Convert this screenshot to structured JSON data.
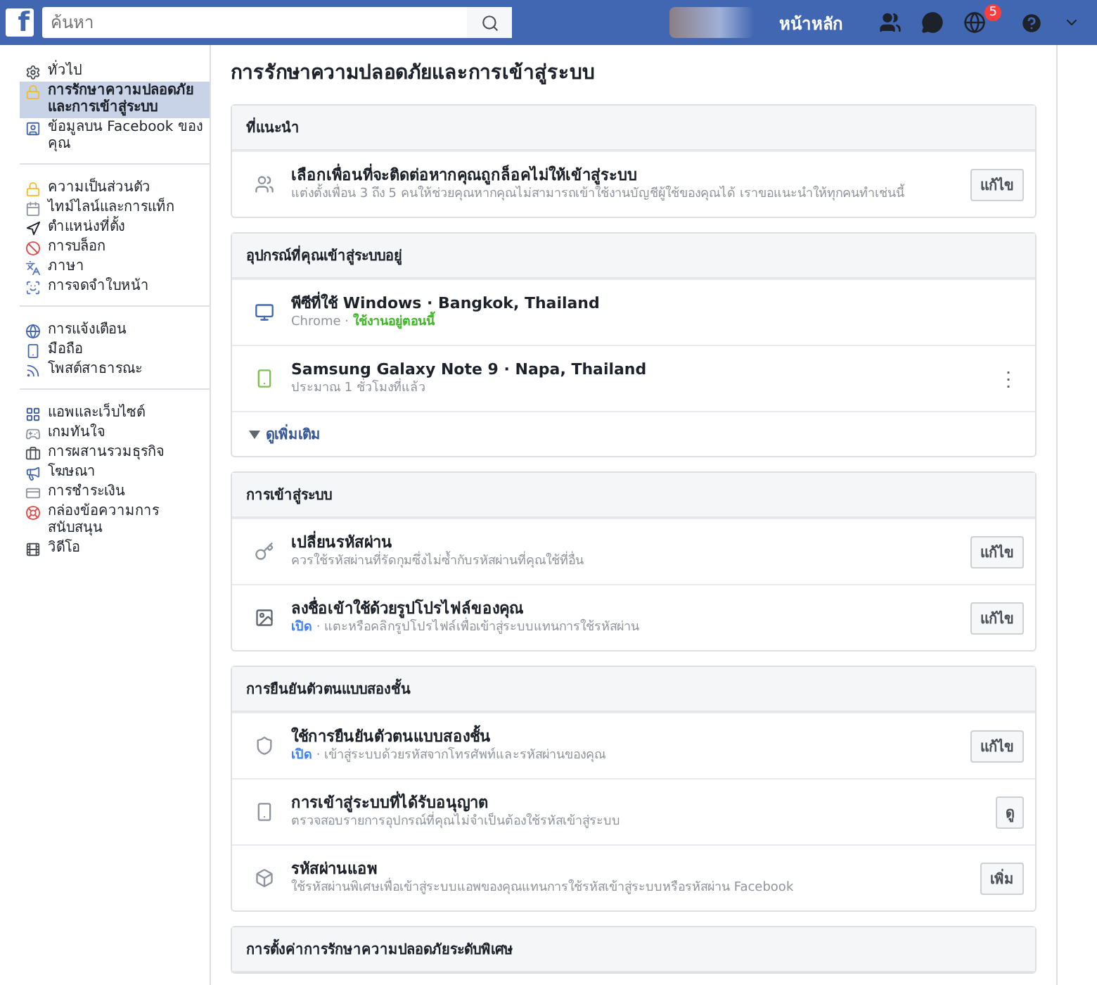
{
  "topbar": {
    "logo": "f",
    "search": {
      "placeholder": "ค้นหา"
    },
    "home": "หน้าหลัก",
    "notification_count": "5"
  },
  "sidebar": {
    "groups": [
      [
        {
          "label": "ทั่วไป",
          "selected": false
        },
        {
          "label": "การรักษาความปลอดภัยและการเข้าสู่ระบบ",
          "selected": true
        },
        {
          "label": "ข้อมูลบน Facebook ของคุณ",
          "selected": false
        }
      ],
      [
        {
          "label": "ความเป็นส่วนตัว",
          "selected": false
        },
        {
          "label": "ไทม์ไลน์และการแท็ก",
          "selected": false
        },
        {
          "label": "ตำแหน่งที่ตั้ง",
          "selected": false
        },
        {
          "label": "การบล็อก",
          "selected": false
        },
        {
          "label": "ภาษา",
          "selected": false
        },
        {
          "label": "การจดจำใบหน้า",
          "selected": false
        }
      ],
      [
        {
          "label": "การแจ้งเตือน",
          "selected": false
        },
        {
          "label": "มือถือ",
          "selected": false
        },
        {
          "label": "โพสต์สาธารณะ",
          "selected": false
        }
      ],
      [
        {
          "label": "แอพและเว็บไซต์",
          "selected": false
        },
        {
          "label": "เกมทันใจ",
          "selected": false
        },
        {
          "label": "การผสานรวมธุรกิจ",
          "selected": false
        },
        {
          "label": "โฆษณา",
          "selected": false
        },
        {
          "label": "การชำระเงิน",
          "selected": false
        },
        {
          "label": "กล่องข้อความการสนับสนุน",
          "selected": false
        },
        {
          "label": "วิดีโอ",
          "selected": false
        }
      ]
    ]
  },
  "title": "การรักษาความปลอดภัยและการเข้าสู่ระบบ",
  "sections": [
    {
      "header": "ที่แนะนำ",
      "rows": [
        {
          "kind": "setting",
          "title": "เลือกเพื่อนที่จะติดต่อหากคุณถูกล็อคไม่ให้เข้าสู่ระบบ",
          "description": "แต่งตั้งเพื่อน 3 ถึง 5 คนให้ช่วยคุณหากคุณไม่สามารถเข้าใช้งานบัญชีผู้ใช้ของคุณได้ เราขอแนะนำให้ทุกคนทำเช่นนี้",
          "button": "แก้ไข"
        }
      ]
    },
    {
      "header": "อุปกรณ์ที่คุณเข้าสู่ระบบอยู่",
      "rows": [
        {
          "kind": "device",
          "title": "พีซีที่ใช้ Windows · Bangkok, Thailand",
          "description": "Chrome ·",
          "status": "ใช้งานอยู่ตอนนี้"
        },
        {
          "kind": "device",
          "title": "Samsung Galaxy Note 9 · Napa, Thailand",
          "description": "ประมาณ 1 ชั่วโมงที่แล้ว",
          "menu": "⋮"
        }
      ],
      "more": "ดูเพิ่มเติม"
    },
    {
      "header": "การเข้าสู่ระบบ",
      "rows": [
        {
          "kind": "setting",
          "title": "เปลี่ยนรหัสผ่าน",
          "description": "ควรใช้รหัสผ่านที่รัดกุมซึ่งไม่ซ้ำกับรหัสผ่านที่คุณใช้ที่อื่น",
          "button": "แก้ไข"
        },
        {
          "kind": "setting",
          "title": "ลงชื่อเข้าใช้ด้วยรูปโปรไฟล์ของคุณ",
          "status": "เปิด",
          "description": "· แตะหรือคลิกรูปโปรไฟล์เพื่อเข้าสู่ระบบแทนการใช้รหัสผ่าน",
          "button": "แก้ไข"
        }
      ]
    },
    {
      "header": "การยืนยันตัวตนแบบสองชั้น",
      "rows": [
        {
          "kind": "setting",
          "title": "ใช้การยืนยันตัวตนแบบสองชั้น",
          "status": "เปิด",
          "description": "· เข้าสู่ระบบด้วยรหัสจากโทรศัพท์และรหัสผ่านของคุณ",
          "button": "แก้ไข"
        },
        {
          "kind": "setting",
          "title": "การเข้าสู่ระบบที่ได้รับอนุญาต",
          "description": "ตรวจสอบรายการอุปกรณ์ที่คุณไม่จำเป็นต้องใช้รหัสเข้าสู่ระบบ",
          "button": "ดู"
        },
        {
          "kind": "setting",
          "title": "รหัสผ่านแอพ",
          "description": "ใช้รหัสผ่านพิเศษเพื่อเข้าสู่ระบบแอพของคุณแทนการใช้รหัสเข้าสู่ระบบหรือรหัสผ่าน Facebook",
          "button": "เพิ่ม"
        }
      ]
    },
    {
      "header": "การตั้งค่าการรักษาความปลอดภัยระดับพิเศษ"
    }
  ]
}
